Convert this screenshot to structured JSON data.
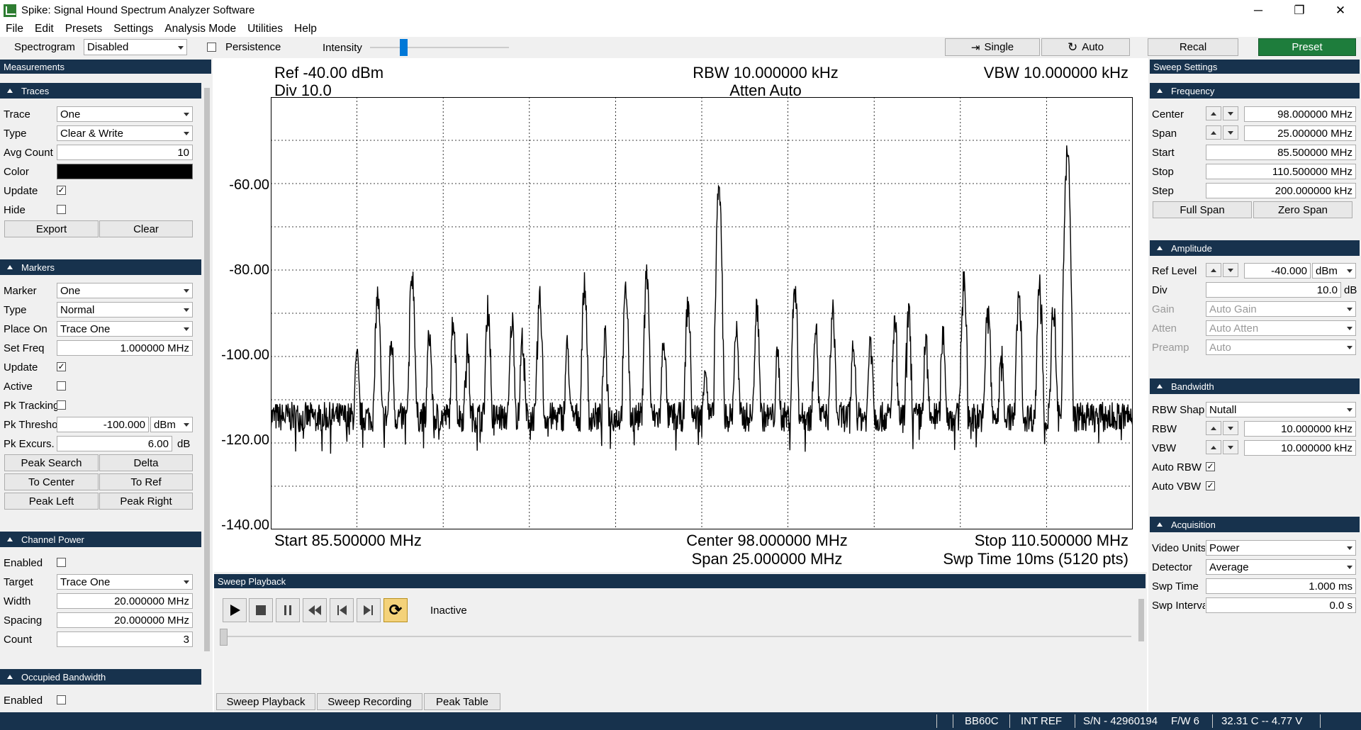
{
  "window": {
    "title": "Spike: Signal Hound Spectrum Analyzer Software",
    "minimize": "─",
    "maximize": "❐",
    "close": "✕"
  },
  "menu": [
    "File",
    "Edit",
    "Presets",
    "Settings",
    "Analysis Mode",
    "Utilities",
    "Help"
  ],
  "toolbar": {
    "spectrogram_label": "Spectrogram",
    "spectrogram_value": "Disabled",
    "persistence_label": "Persistence",
    "intensity_label": "Intensity",
    "single_label": "Single",
    "auto_label": "Auto",
    "recal_label": "Recal",
    "preset_label": "Preset",
    "preset_color": "#1e7d3c"
  },
  "left": {
    "title": "Measurements",
    "traces": {
      "head": "Traces",
      "trace_label": "Trace",
      "trace_value": "One",
      "type_label": "Type",
      "type_value": "Clear & Write",
      "avg_label": "Avg Count",
      "avg_value": "10",
      "color_label": "Color",
      "color_value": "#000000",
      "update_label": "Update",
      "update_checked": "✓",
      "hide_label": "Hide",
      "export_label": "Export",
      "clear_label": "Clear"
    },
    "markers": {
      "head": "Markers",
      "marker_label": "Marker",
      "marker_value": "One",
      "type_label": "Type",
      "type_value": "Normal",
      "place_label": "Place On",
      "place_value": "Trace One",
      "setfreq_label": "Set Freq",
      "setfreq_value": "1.000000 MHz",
      "update_label": "Update",
      "update_checked": "✓",
      "active_label": "Active",
      "pktrack_label": "Pk Tracking",
      "pkthresh_label": "Pk Threshold",
      "pkthresh_value": "-100.000",
      "pkthresh_unit": "dBm",
      "pkexc_label": "Pk Excurs.",
      "pkexc_value": "6.00",
      "pkexc_unit": "dB",
      "peak_search": "Peak Search",
      "delta": "Delta",
      "to_center": "To Center",
      "to_ref": "To Ref",
      "peak_left": "Peak Left",
      "peak_right": "Peak Right"
    },
    "channel_power": {
      "head": "Channel Power",
      "enabled_label": "Enabled",
      "target_label": "Target",
      "target_value": "Trace One",
      "width_label": "Width",
      "width_value": "20.000000 MHz",
      "spacing_label": "Spacing",
      "spacing_value": "20.000000 MHz",
      "count_label": "Count",
      "count_value": "3"
    },
    "occupied_bw": {
      "head": "Occupied Bandwidth",
      "enabled_label": "Enabled"
    }
  },
  "display": {
    "ref": "Ref -40.00 dBm",
    "div": "Div 10.0",
    "rbw": "RBW 10.000000 kHz",
    "atten": "Atten Auto",
    "vbw": "VBW 10.000000 kHz",
    "start": "Start 85.500000 MHz",
    "center": "Center 98.000000 MHz",
    "span": "Span 25.000000 MHz",
    "stop": "Stop 110.500000 MHz",
    "swp": "Swp Time 10ms (5120 pts)"
  },
  "chart_data": {
    "type": "line",
    "xlabel": "",
    "ylabel": "",
    "xlim": [
      85.5,
      110.5
    ],
    "ylim": [
      -140,
      -40
    ],
    "y_ticks": [
      "-60.00",
      "-80.00",
      "-100.00",
      "-120.00",
      "-140.00"
    ],
    "grid": true,
    "noise_floor": -114,
    "series": [
      {
        "x": [
          85.5,
          88.0,
          88.6,
          89.0,
          89.6,
          90.1,
          90.8,
          91.2,
          91.8,
          92.5,
          92.8,
          93.3,
          94.1,
          94.6,
          95.2,
          95.8,
          96.4,
          96.9,
          97.6,
          98.1,
          98.5,
          99.0,
          99.6,
          100.2,
          100.7,
          101.3,
          101.8,
          102.4,
          102.9,
          103.6,
          104.0,
          104.5,
          105.0,
          105.6,
          106.3,
          106.7,
          107.2,
          107.8,
          108.2,
          108.6,
          110.5
        ],
        "y": [
          -114,
          -101,
          -86,
          -97,
          -81,
          -95,
          -91,
          -98,
          -89,
          -92,
          -96,
          -87,
          -98,
          -84,
          -96,
          -85,
          -81,
          -96,
          -88,
          -102,
          -62,
          -94,
          -89,
          -100,
          -84,
          -93,
          -90,
          -97,
          -95,
          -92,
          -90,
          -97,
          -95,
          -82,
          -88,
          -99,
          -86,
          -83,
          -89,
          -53,
          -114
        ]
      }
    ]
  },
  "playback": {
    "head": "Sweep Playback",
    "status": "Inactive",
    "tabs": [
      "Sweep Playback",
      "Sweep Recording",
      "Peak Table"
    ],
    "icons": [
      "play-icon",
      "stop-icon",
      "pause-icon",
      "rewind-icon",
      "skip-back-icon",
      "skip-forward-icon",
      "loop-icon"
    ]
  },
  "right": {
    "title": "Sweep Settings",
    "frequency": {
      "head": "Frequency",
      "center_label": "Center",
      "center_value": "98.000000 MHz",
      "span_label": "Span",
      "span_value": "25.000000 MHz",
      "start_label": "Start",
      "start_value": "85.500000 MHz",
      "stop_label": "Stop",
      "stop_value": "110.500000 MHz",
      "step_label": "Step",
      "step_value": "200.000000 kHz",
      "full_span": "Full Span",
      "zero_span": "Zero Span"
    },
    "amplitude": {
      "head": "Amplitude",
      "ref_label": "Ref Level",
      "ref_value": "-40.000",
      "ref_unit": "dBm",
      "div_label": "Div",
      "div_value": "10.0",
      "div_unit": "dB",
      "gain_label": "Gain",
      "gain_value": "Auto Gain",
      "atten_label": "Atten",
      "atten_value": "Auto Atten",
      "preamp_label": "Preamp",
      "preamp_value": "Auto"
    },
    "bandwidth": {
      "head": "Bandwidth",
      "shape_label": "RBW Shape",
      "shape_value": "Nutall",
      "rbw_label": "RBW",
      "rbw_value": "10.000000 kHz",
      "vbw_label": "VBW",
      "vbw_value": "10.000000 kHz",
      "autorbw_label": "Auto RBW",
      "autorbw_checked": "✓",
      "autovbw_label": "Auto VBW",
      "autovbw_checked": "✓"
    },
    "acquisition": {
      "head": "Acquisition",
      "video_label": "Video Units",
      "video_value": "Power",
      "detector_label": "Detector",
      "detector_value": "Average",
      "swptime_label": "Swp Time",
      "swptime_value": "1.000 ms",
      "swpint_label": "Swp Interval",
      "swpint_value": "0.0 s"
    }
  },
  "status": {
    "device": "BB60C",
    "ref": "INT REF",
    "serial": "S/N - 42960194",
    "fw": "F/W 6",
    "temp": "32.31 C  --  4.77 V"
  }
}
